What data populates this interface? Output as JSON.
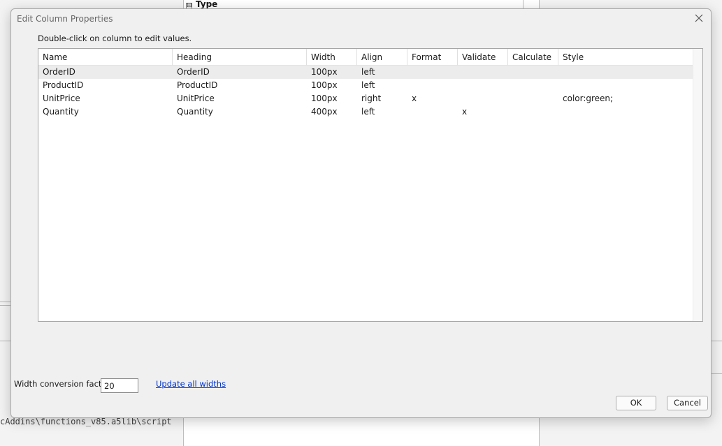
{
  "background": {
    "type_section_header": "Type",
    "collapse_glyph": "⊟",
    "script_path_text": "cAddins\\functions_v85.a5lib\\script"
  },
  "dialog": {
    "title": "Edit Column Properties",
    "close_icon": "close-icon",
    "hint": "Double-click on column to edit values.",
    "grid": {
      "columns": [
        "Name",
        "Heading",
        "Width",
        "Align",
        "Format",
        "Validate",
        "Calculate",
        "Style"
      ],
      "selected_row": 0,
      "rows": [
        [
          "OrderID",
          "OrderID",
          "100px",
          "left",
          "",
          "",
          "",
          ""
        ],
        [
          "ProductID",
          "ProductID",
          "100px",
          "left",
          "",
          "",
          "",
          ""
        ],
        [
          "UnitPrice",
          "UnitPrice",
          "100px",
          "right",
          "x",
          "",
          "",
          "color:green;"
        ],
        [
          "Quantity",
          "Quantity",
          "400px",
          "left",
          "",
          "x",
          "",
          ""
        ]
      ]
    },
    "width_conversion": {
      "label": "Width conversion factor:",
      "value": "20"
    },
    "update_link": "Update all widths",
    "ok_label": "OK",
    "cancel_label": "Cancel"
  },
  "colors": {
    "link": "#0033cc",
    "selected_row": "#ececec",
    "dialog_bg": "#f0f0f0"
  }
}
